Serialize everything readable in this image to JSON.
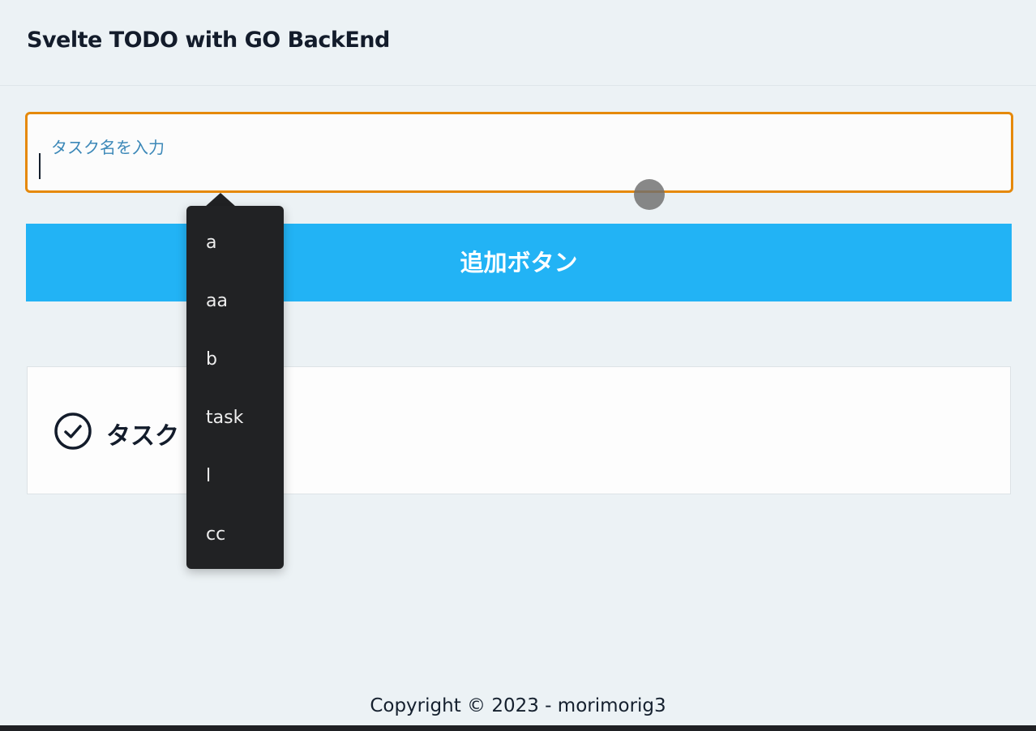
{
  "header": {
    "title": "Svelte TODO with GO BackEnd"
  },
  "task_input": {
    "label": "タスク名を入力",
    "value": ""
  },
  "add_button": {
    "label": "追加ボタン"
  },
  "task_list": [
    {
      "name": "タスク",
      "icon": "check-circle-icon"
    }
  ],
  "autocomplete": {
    "options": [
      "a",
      "aa",
      "b",
      "task",
      "l",
      "cc"
    ]
  },
  "footer": {
    "copyright": "Copyright © 2023 - morimorig3"
  },
  "colors": {
    "accent_border": "#e5890b",
    "button_bg": "#22b3f5",
    "label_color": "#3c88b8",
    "dropdown_bg": "#212224",
    "page_bg": "#ecf2f5"
  }
}
